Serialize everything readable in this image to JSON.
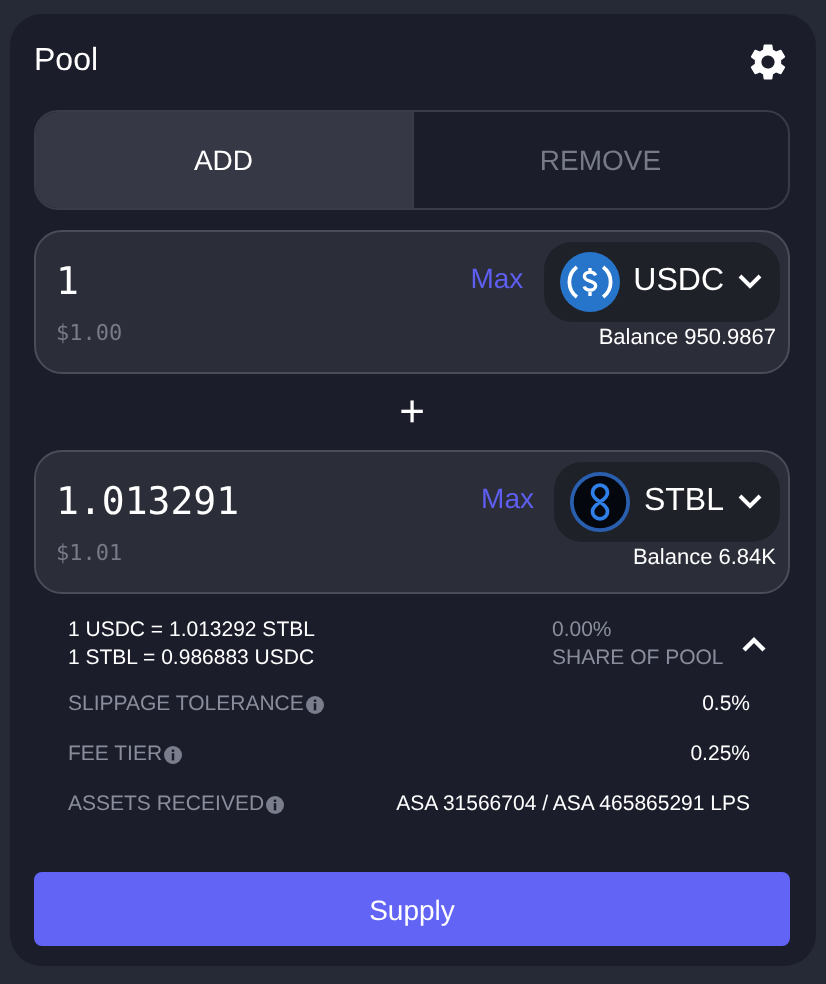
{
  "header": {
    "title": "Pool"
  },
  "tabs": [
    {
      "label": "ADD",
      "selected": true
    },
    {
      "label": "REMOVE",
      "selected": false
    }
  ],
  "inputs": [
    {
      "amount": "1",
      "usd": "$1.00",
      "max": "Max",
      "token": "USDC",
      "kind": "usdc",
      "balance": "Balance 950.9867"
    },
    {
      "amount": "1.013291",
      "usd": "$1.01",
      "max": "Max",
      "token": "STBL",
      "kind": "stbl",
      "balance": "Balance 6.84K"
    }
  ],
  "separator": "+",
  "rates": [
    "1 USDC = 1.013292 STBL",
    "1 STBL = 0.986883 USDC"
  ],
  "share": {
    "value": "0.00%",
    "label": "SHARE OF POOL"
  },
  "details_expanded": true,
  "details": [
    {
      "label": "SLIPPAGE TOLERANCE",
      "value": "0.5%"
    },
    {
      "label": "FEE TIER",
      "value": "0.25%"
    },
    {
      "label": "ASSETS RECEIVED",
      "value": "ASA 31566704 / ASA 465865291 LPS"
    }
  ],
  "submit": "Supply"
}
